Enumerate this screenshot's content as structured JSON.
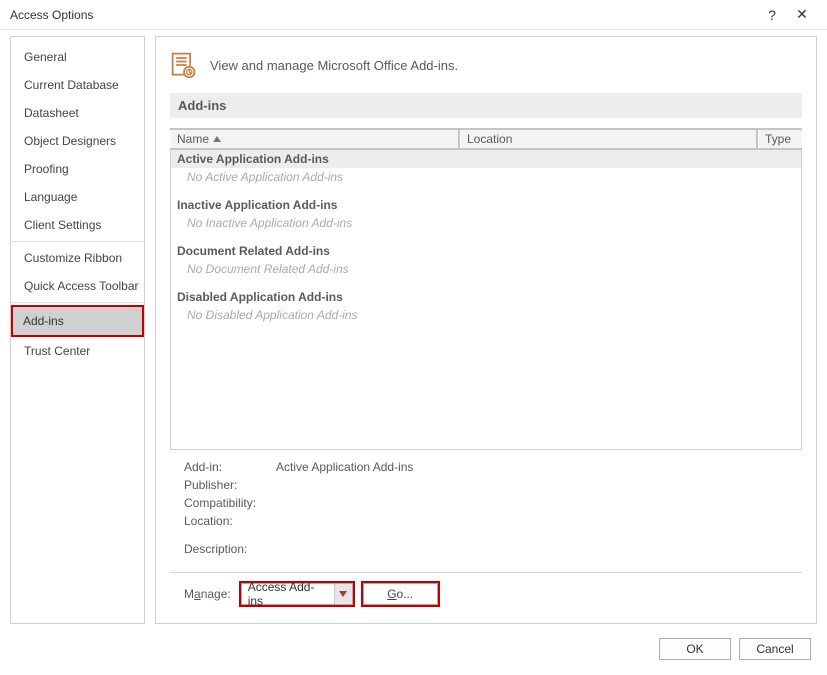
{
  "window": {
    "title": "Access Options",
    "help_icon": "?",
    "close_icon": "✕"
  },
  "sidebar": {
    "items": [
      {
        "label": "General"
      },
      {
        "label": "Current Database"
      },
      {
        "label": "Datasheet"
      },
      {
        "label": "Object Designers"
      },
      {
        "label": "Proofing"
      },
      {
        "label": "Language"
      },
      {
        "label": "Client Settings"
      },
      {
        "sep": true
      },
      {
        "label": "Customize Ribbon"
      },
      {
        "label": "Quick Access Toolbar"
      },
      {
        "sep": true
      },
      {
        "label": "Add-ins",
        "selected": true
      },
      {
        "label": "Trust Center"
      }
    ]
  },
  "page": {
    "description": "View and manage Microsoft Office Add-ins.",
    "section_heading": "Add-ins",
    "columns": {
      "name": "Name",
      "location": "Location",
      "type": "Type"
    },
    "groups": [
      {
        "header": "Active Application Add-ins",
        "empty": "No Active Application Add-ins"
      },
      {
        "header": "Inactive Application Add-ins",
        "empty": "No Inactive Application Add-ins"
      },
      {
        "header": "Document Related Add-ins",
        "empty": "No Document Related Add-ins"
      },
      {
        "header": "Disabled Application Add-ins",
        "empty": "No Disabled Application Add-ins"
      }
    ],
    "details": {
      "addin_label": "Add-in:",
      "addin_value": "Active Application Add-ins",
      "publisher_label": "Publisher:",
      "publisher_value": "",
      "compatibility_label": "Compatibility:",
      "compatibility_value": "",
      "location_label": "Location:",
      "location_value": "",
      "description_label": "Description:",
      "description_value": ""
    },
    "manage": {
      "label_pre": "M",
      "label_u": "a",
      "label_post": "nage:",
      "dropdown_value": "Access Add-ins",
      "go_u": "G",
      "go_post": "o..."
    }
  },
  "footer": {
    "ok": "OK",
    "cancel": "Cancel"
  }
}
